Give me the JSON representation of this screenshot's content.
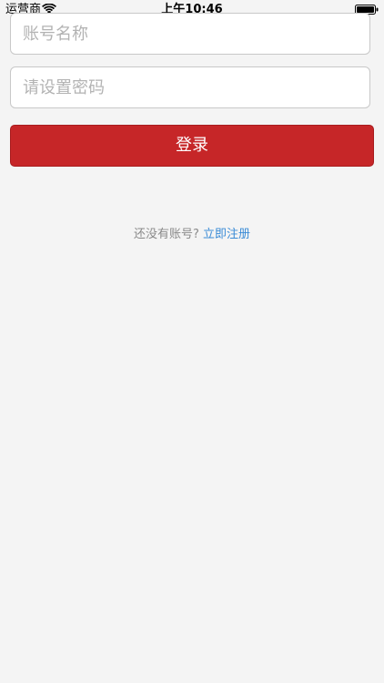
{
  "status_bar": {
    "carrier": "运营商",
    "time": "上午10:46"
  },
  "form": {
    "account_placeholder": "账号名称",
    "password_placeholder": "请设置密码",
    "login_label": "登录"
  },
  "register": {
    "prompt": "还没有账号?",
    "link_label": "立即注册"
  },
  "colors": {
    "background": "#f4f4f4",
    "primary_button": "#c62628",
    "link": "#3a8bd6"
  },
  "icons": {
    "wifi": "wifi-icon",
    "battery": "battery-icon"
  }
}
